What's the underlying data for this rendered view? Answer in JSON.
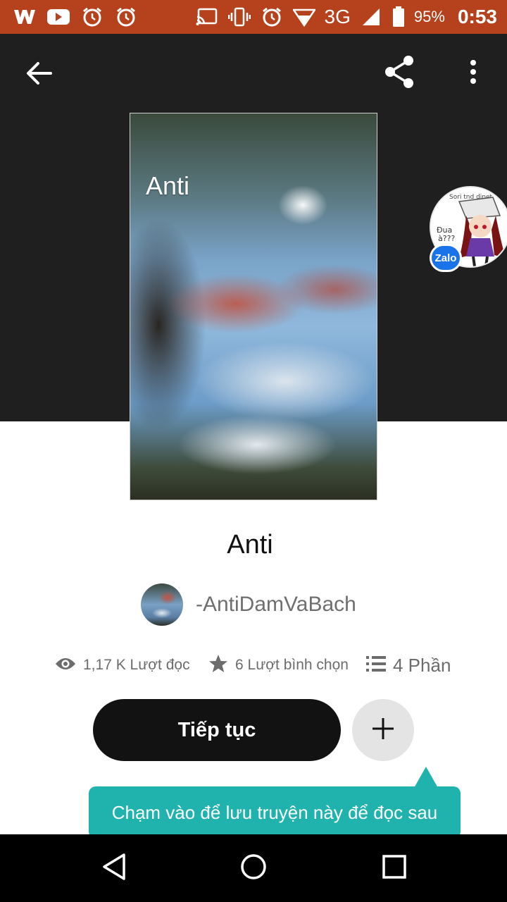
{
  "status_bar": {
    "network": "3G",
    "battery": "95%",
    "time": "0:53",
    "accent_color": "#b5421d",
    "left_icons": [
      "wattpad-icon",
      "youtube-icon",
      "alarm-icon",
      "alarm-icon"
    ],
    "right_icons": [
      "cast-icon",
      "vibrate-icon",
      "alarm-icon",
      "wifi-icon",
      "signal-icon",
      "battery-icon"
    ]
  },
  "header": {
    "back_icon": "arrow-left-icon",
    "share_icon": "share-icon",
    "more_icon": "more-vertical-icon"
  },
  "cover": {
    "title": "Anti"
  },
  "zalo": {
    "badge": "Zalo",
    "bubble_caption": "Sori tnd dinet",
    "bubble_note": "Đua\nà???"
  },
  "story": {
    "title": "Anti",
    "author": "-AntiDamVaBach"
  },
  "stats": {
    "reads": "1,17 K Lượt đọc",
    "votes": "6 Lượt bình chọn",
    "parts": "4 Phần"
  },
  "actions": {
    "continue_label": "Tiếp tục",
    "add_icon": "plus-icon"
  },
  "tooltip": {
    "text": "Chạm vào để lưu truyện này để đọc sau",
    "color": "#20b3ad"
  },
  "navbar": {
    "icons": [
      "nav-back-icon",
      "nav-home-icon",
      "nav-recents-icon"
    ]
  }
}
